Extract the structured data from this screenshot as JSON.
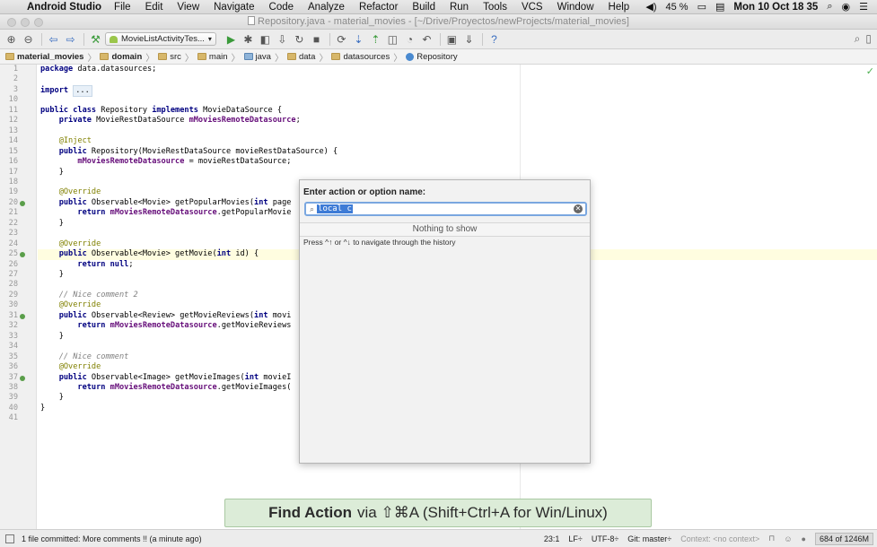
{
  "menubar": {
    "app_name": "Android Studio",
    "items": [
      "File",
      "Edit",
      "View",
      "Navigate",
      "Code",
      "Analyze",
      "Refactor",
      "Build",
      "Run",
      "Tools",
      "VCS",
      "Window",
      "Help"
    ],
    "volume_icon": "speaker-icon",
    "battery": "45 %",
    "clock": "Mon 10 Oct  18 35"
  },
  "window": {
    "title": "Repository.java - material_movies - [~/Drive/Proyectos/newProjects/material_movies]"
  },
  "toolbar": {
    "run_config": "MovieListActivityTes..."
  },
  "breadcrumb": [
    {
      "label": "material_movies",
      "bold": true
    },
    {
      "label": "domain",
      "bold": true
    },
    {
      "label": "src"
    },
    {
      "label": "main"
    },
    {
      "label": "java"
    },
    {
      "label": "data"
    },
    {
      "label": "datasources"
    },
    {
      "label": "Repository"
    }
  ],
  "editor": {
    "caret_line": 23
  },
  "find_action": {
    "prompt": "Enter action or option name:",
    "query": "local c",
    "empty_text": "Nothing to show",
    "hint": "Press ^↑ or ^↓ to navigate through the history"
  },
  "tip": {
    "bold": "Find Action",
    "rest": "via ⇧⌘A (Shift+Ctrl+A for Win/Linux)"
  },
  "statusbar": {
    "message": "1 file committed: More comments !! (a minute ago)",
    "position": "23:1",
    "line_sep": "LF÷",
    "encoding": "UTF-8÷",
    "git": "Git: master÷",
    "context": "Context: <no context>",
    "memory": "684 of 1246M"
  }
}
